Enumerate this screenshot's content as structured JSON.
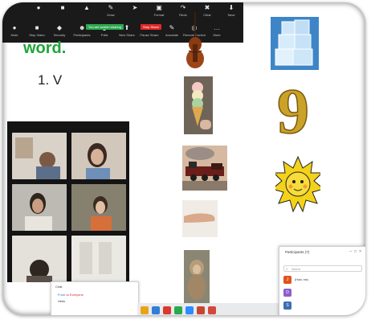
{
  "zoom_toolbar": {
    "top_items": [
      {
        "label": "",
        "icon": "mic-icon"
      },
      {
        "label": "",
        "icon": "video-icon"
      },
      {
        "label": "",
        "icon": "share-icon"
      },
      {
        "label": "Draw",
        "icon": "pencil-icon"
      },
      {
        "label": "",
        "icon": "pointer-icon"
      },
      {
        "label": "Format",
        "icon": "format-icon"
      },
      {
        "label": "Redo",
        "icon": "redo-icon"
      },
      {
        "label": "Clear",
        "icon": "trash-icon"
      },
      {
        "label": "Save",
        "icon": "save-icon"
      }
    ],
    "bottom_items": [
      {
        "label": "Mute",
        "icon": "mic-icon"
      },
      {
        "label": "Stop Video",
        "icon": "video-icon"
      },
      {
        "label": "Security",
        "icon": "shield-icon"
      },
      {
        "label": "Participants",
        "icon": "participants-icon"
      },
      {
        "label": "Polls",
        "icon": "polls-icon"
      },
      {
        "label": "New Share",
        "icon": "share-up-icon"
      },
      {
        "label": "Pause Share",
        "icon": "pause-icon"
      },
      {
        "label": "Annotate",
        "icon": "annotate-icon"
      },
      {
        "label": "Remote Control",
        "icon": "remote-icon"
      },
      {
        "label": "More",
        "icon": "more-icon"
      }
    ],
    "sharing_indicator": "You are screen sharing",
    "stop_share": "Stop Share"
  },
  "slide": {
    "heading": "word.",
    "line1": "1. V",
    "number_image": "9"
  },
  "gallery": {
    "tiles": [
      {
        "name": ""
      },
      {
        "name": "",
        "active": true
      },
      {
        "name": ""
      },
      {
        "name": ""
      },
      {
        "name": ""
      },
      {
        "name": ""
      },
      {
        "name": ""
      },
      {
        "name": ""
      }
    ]
  },
  "chat": {
    "header": "Chat",
    "line1_prefix": "From ",
    "line1_target": "to Everyone",
    "line2": "Hello"
  },
  "participants_panel": {
    "title": "Participants (7)",
    "search_placeholder": "Search",
    "rows": [
      {
        "initial": "J",
        "color": "#e0531f",
        "name": "(Host, me)"
      },
      {
        "initial": "D",
        "color": "#8e5ec9",
        "name": ""
      },
      {
        "initial": "S",
        "color": "#3a6fb0",
        "name": ""
      }
    ]
  },
  "colors": {
    "heading_green": "#1fa53a",
    "toolbar_bg": "#1a1a1a",
    "share_green": "#2da94f",
    "stop_red": "#e02828",
    "gold": "#c9a227"
  }
}
